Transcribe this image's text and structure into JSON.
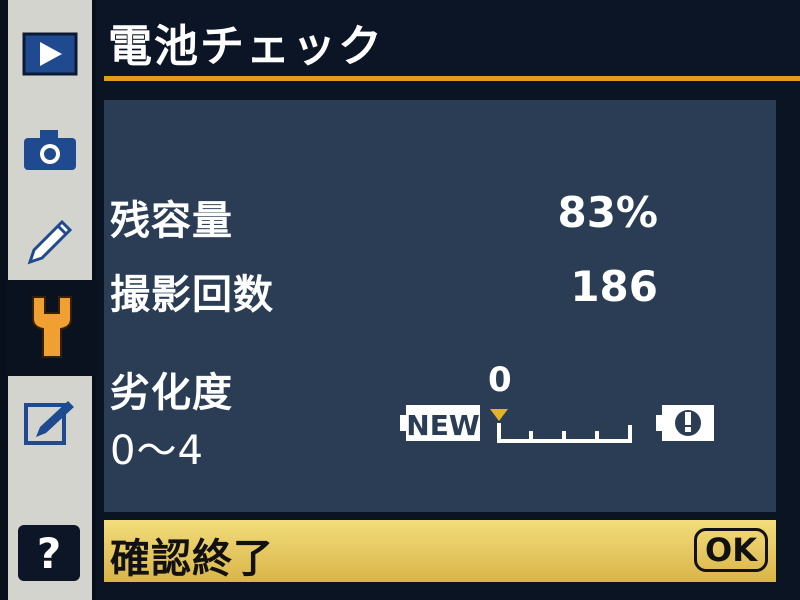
{
  "menu": {
    "items": [
      {
        "icon": "playback-icon"
      },
      {
        "icon": "camera-icon"
      },
      {
        "icon": "pencil-icon"
      },
      {
        "icon": "wrench-icon",
        "active": true
      },
      {
        "icon": "retouch-icon"
      },
      {
        "icon": "help-icon",
        "label": "?"
      }
    ]
  },
  "header": {
    "title": "電池チェック"
  },
  "battery": {
    "remaining_label": "残容量",
    "remaining_value": "83%",
    "shots_label": "撮影回数",
    "shots_value": "186",
    "degradation_label": "劣化度",
    "degradation_range": "0〜4",
    "degradation_value": "0",
    "gauge_new_label": "NEW"
  },
  "footer": {
    "label": "確認終了",
    "ok_label": "OK"
  },
  "colors": {
    "accent": "#e39b1d",
    "panel": "#2a3d55",
    "footer": "#e8c866",
    "active_icon": "#f0a030"
  }
}
